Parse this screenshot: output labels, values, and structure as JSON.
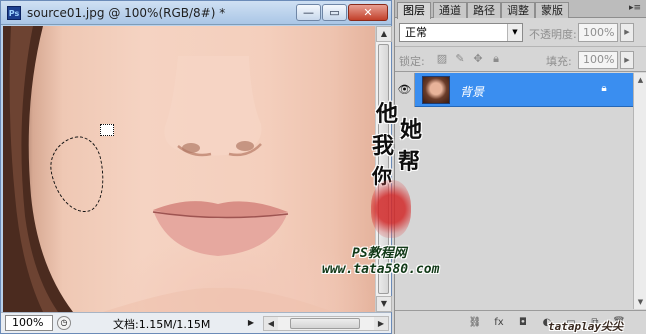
{
  "document": {
    "app_icon": "Ps",
    "title": "source01.jpg @ 100%(RGB/8#) *",
    "controls": {
      "minimize_icon": "minimize-icon",
      "maximize_icon": "maximize-icon",
      "close_icon": "close-icon",
      "minimize": "—",
      "maximize": "▭",
      "close": "✕"
    }
  },
  "status": {
    "zoom": "100%",
    "doc_size": "文档:1.15M/1.15M",
    "arrow": "▶"
  },
  "panel": {
    "tabs": [
      "图层",
      "通道",
      "路径",
      "调整",
      "蒙版"
    ],
    "active_tab": "图层",
    "menu_icon": "▸≡",
    "blend_mode": "正常",
    "opacity_label": "不透明度:",
    "opacity_value": "100%",
    "lock_label": "锁定:",
    "fill_label": "填充:",
    "fill_value": "100%",
    "layers": [
      {
        "name": "背景",
        "visible": true,
        "locked": true,
        "selected": true
      }
    ],
    "footer_icons": [
      "link-icon",
      "fx-icon",
      "mask-icon",
      "adjustment-icon",
      "group-icon",
      "new-layer-icon",
      "trash-icon"
    ]
  },
  "watermark": {
    "calligraphy": [
      "他",
      "她",
      "我",
      "帮",
      "你"
    ],
    "site_cn": "PS教程网",
    "site_url": "www.tata580.com",
    "corner": "tataplay尖尖"
  },
  "colors": {
    "selection": "#3a8ef0",
    "titlebar": "#b9d1ea",
    "panel_bg": "#d6d6d6"
  }
}
